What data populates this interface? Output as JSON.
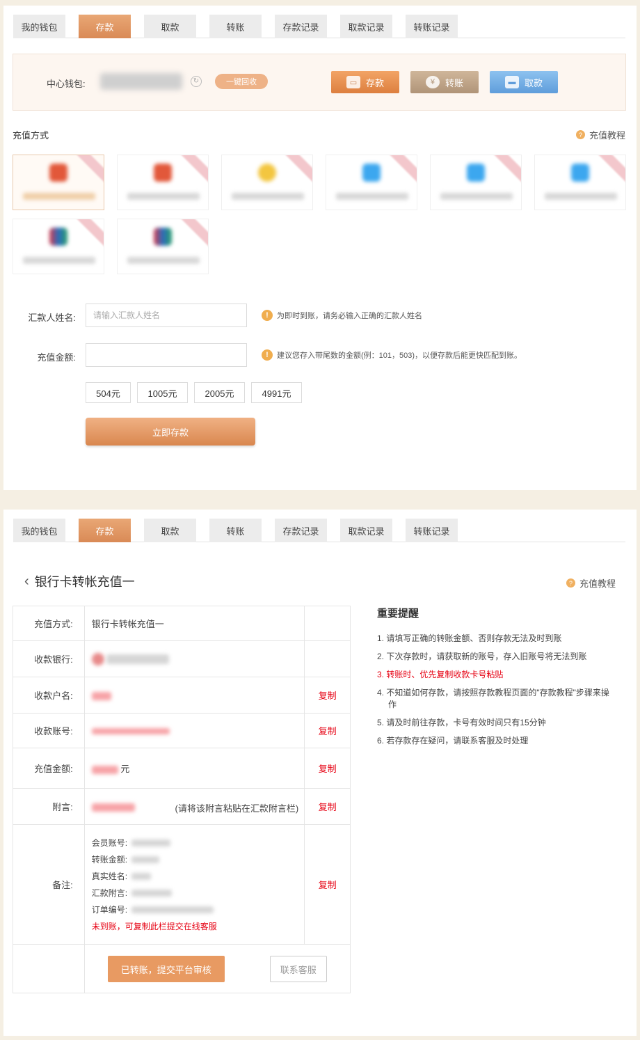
{
  "tabs": [
    "我的钱包",
    "存款",
    "取款",
    "转账",
    "存款记录",
    "取款记录",
    "转账记录"
  ],
  "active_tab": "存款",
  "wallet": {
    "label": "中心钱包:",
    "reclaim_label": "一键回收",
    "deposit_label": "存款",
    "transfer_label": "转账",
    "withdraw_label": "取款"
  },
  "recharge": {
    "title": "充值方式",
    "help_label": "充值教程"
  },
  "form": {
    "remitter_label": "汇款人姓名:",
    "remitter_placeholder": "请输入汇款人姓名",
    "remitter_hint": "为即时到账，请务必输入正确的汇款人姓名",
    "amount_label": "充值金额:",
    "amount_hint": "建议您存入带尾数的金额(例：101，503)，以便存款后能更快匹配到账。",
    "quick_amounts": [
      "504元",
      "1005元",
      "2005元",
      "4991元"
    ],
    "submit_label": "立即存款"
  },
  "detail": {
    "title": "银行卡转帐充值一",
    "help_label": "充值教程",
    "rows": {
      "method_label": "充值方式:",
      "method_value": "银行卡转帐充值一",
      "bank_label": "收款银行:",
      "account_name_label": "收款户名:",
      "account_no_label": "收款账号:",
      "amount_label": "充值金额:",
      "amount_unit": "元",
      "memo_label": "附言:",
      "memo_note": "(请将该附言粘贴在汇款附言栏)",
      "remark_label": "备注:",
      "copy_label": "复制"
    },
    "remark_lines": [
      "会员账号:",
      "转账金额:",
      "真实姓名:",
      "汇款附言:",
      "订单编号:"
    ],
    "remark_warning": "未到账，可复制此栏提交在线客服",
    "confirm_label": "已转账，提交平台审核",
    "cs_label": "联系客服"
  },
  "notice": {
    "title": "重要提醒",
    "items": [
      "1. 请填写正确的转账金额、否则存款无法及时到账",
      "2. 下次存款时，请获取新的账号，存入旧账号将无法到账",
      "3. 转账时、优先复制收款卡号粘贴",
      "4. 不知道如何存款，请按照存款教程页面的\"存款教程\"步骤来操作",
      "5. 请及时前往存款，卡号有效时间只有15分钟",
      "6. 若存款存在疑问，请联系客服及时处理"
    ]
  },
  "colors": {
    "accent": "#d98a56",
    "warning_red": "#e60012"
  }
}
